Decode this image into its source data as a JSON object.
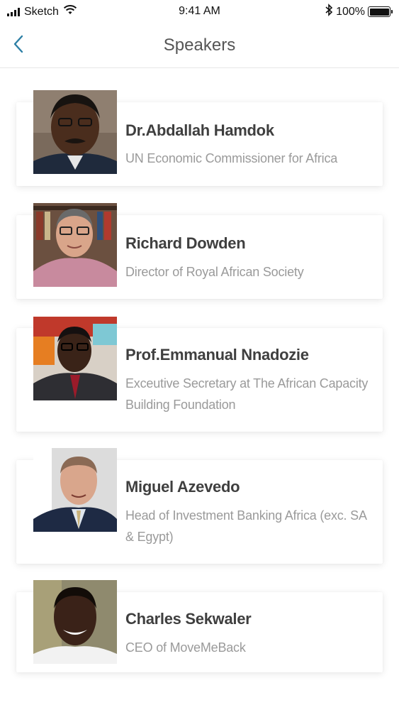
{
  "status_bar": {
    "carrier": "Sketch",
    "time": "9:41 AM",
    "battery": "100%",
    "battery_level": 1.0,
    "icons": [
      "signal-icon",
      "wifi-icon",
      "bluetooth-icon",
      "battery-icon"
    ]
  },
  "nav": {
    "title": "Speakers",
    "back_icon": "chevron-left-icon"
  },
  "colors": {
    "accent": "#2d7fa5",
    "name_text": "#3f3f3f",
    "role_text": "#9a9a9a"
  },
  "speakers": [
    {
      "name": "Dr.Abdallah  Hamdok",
      "role": "UN Economic Commissioner for Africa"
    },
    {
      "name": "Richard Dowden",
      "role": "Director of Royal African Society"
    },
    {
      "name": "Prof.Emmanual Nnadozie",
      "role": "Exceutive Secretary at The African Capacity Building Foundation"
    },
    {
      "name": "Miguel Azevedo",
      "role": "Head of Investment Banking Africa (exc. SA & Egypt)"
    },
    {
      "name": "Charles Sekwaler",
      "role": "CEO of MoveMeBack"
    }
  ]
}
